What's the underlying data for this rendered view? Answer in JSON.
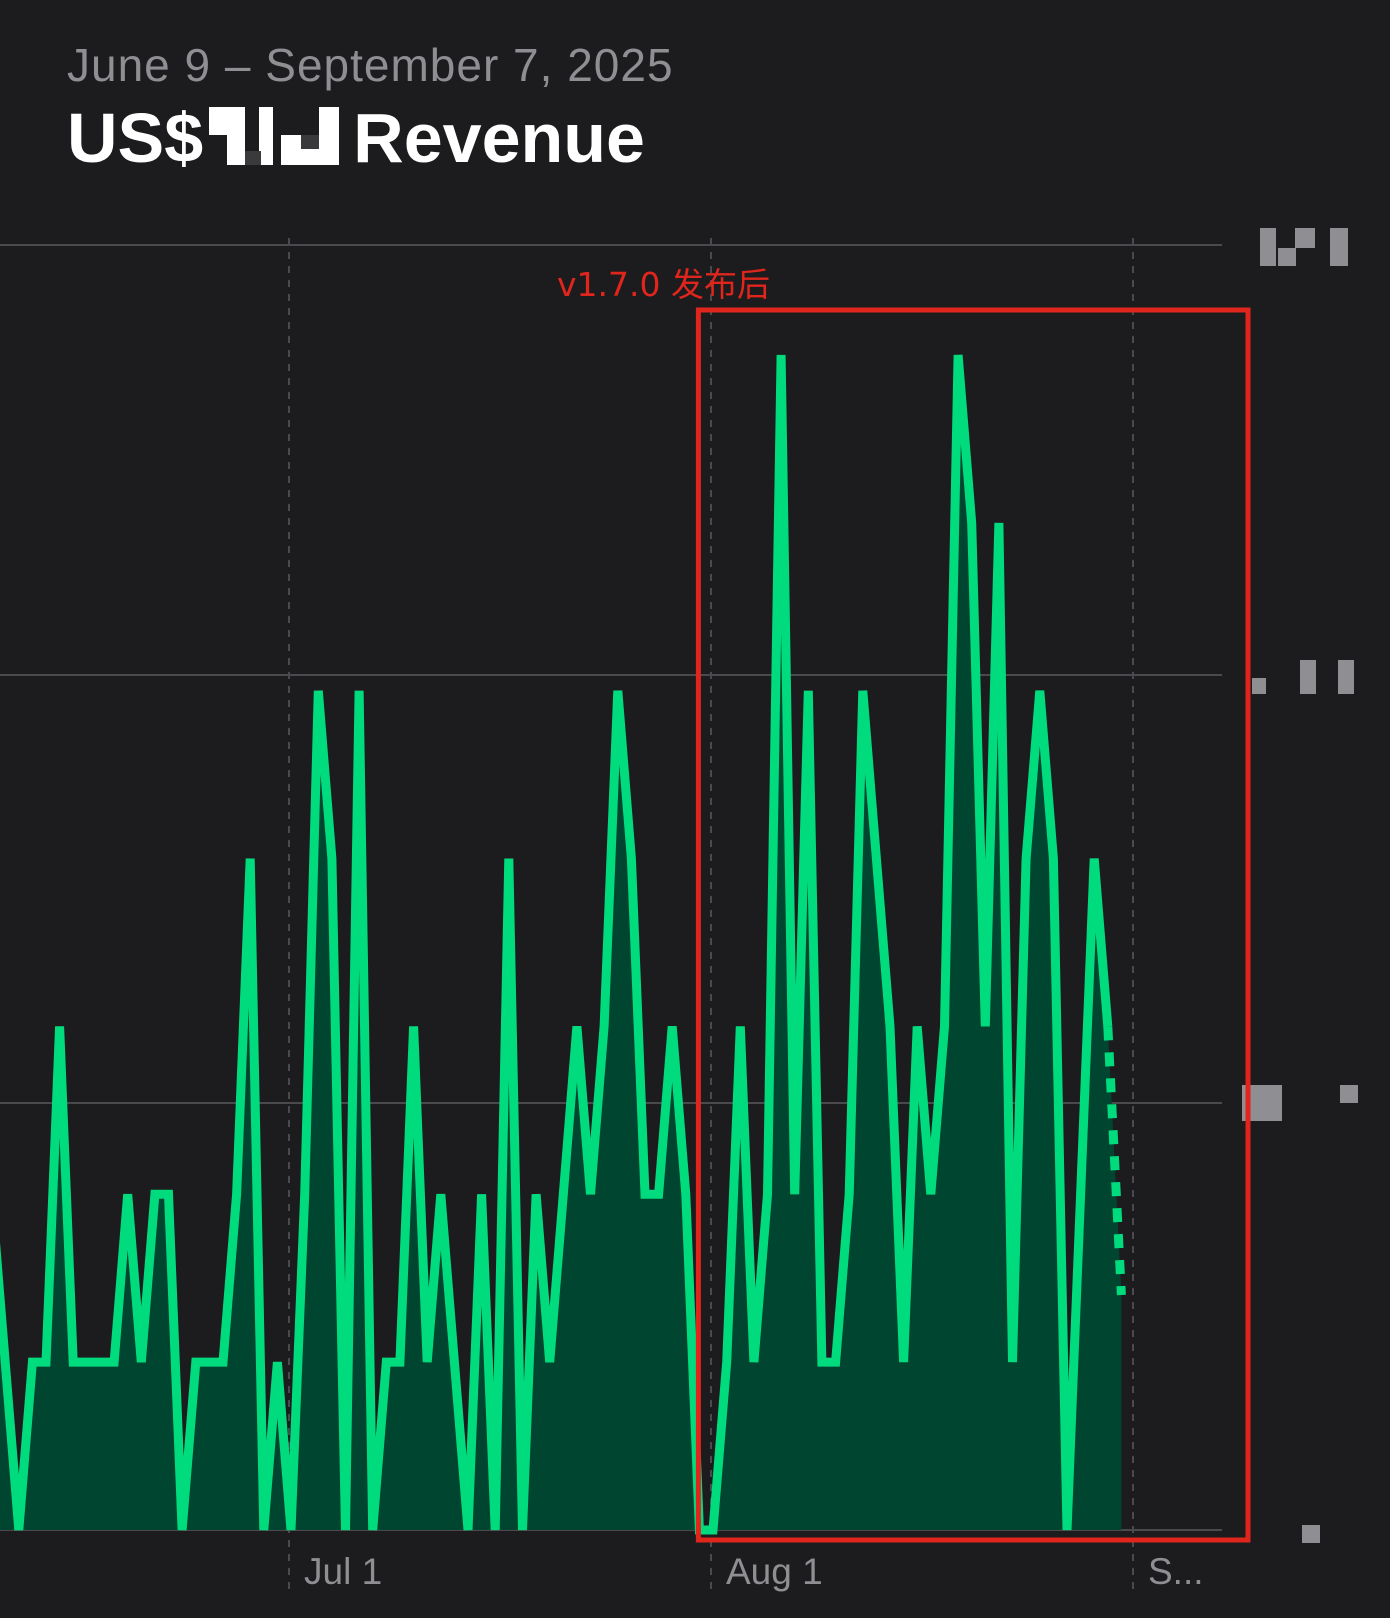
{
  "header": {
    "date_range": "June 9 – September 7, 2025",
    "currency_prefix": "US$",
    "title": "Revenue"
  },
  "colors": {
    "background": "#1c1c1e",
    "line": "#00dc7d",
    "area_fill": "#00452f",
    "gridline": "#4a4a4e",
    "annotation": "#e0261c"
  },
  "annotation": {
    "label": "v1.7.0 发布后",
    "start_date": "2025-07-31",
    "end_date": "2025-09-06"
  },
  "chart_data": {
    "type": "area",
    "title": "Revenue",
    "subtitle": "June 9 – September 7, 2025",
    "xlabel": "",
    "ylabel": "",
    "x_tick_labels": [
      "Jul 1",
      "Aug 1",
      "S..."
    ],
    "x_ticks": [
      "2025-07-01",
      "2025-08-01",
      "2025-09-01"
    ],
    "y_tick_labels_redacted": true,
    "ylim": [
      0,
      3
    ],
    "grid": true,
    "legend": "none",
    "x_start": "2025-06-09",
    "x_end": "2025-09-07",
    "series": [
      {
        "values": [
          1,
          2,
          2,
          1,
          0,
          1,
          1,
          3,
          1,
          1,
          1,
          1,
          2,
          1,
          2,
          2,
          0,
          1,
          1,
          1,
          2,
          4,
          0,
          1,
          0,
          2,
          5,
          4,
          0,
          5,
          0,
          1,
          1,
          3,
          1,
          2,
          1,
          0,
          2,
          0,
          4,
          0,
          2,
          1,
          2,
          3,
          2,
          3,
          5,
          4,
          2,
          2,
          3,
          2,
          0,
          0,
          1,
          3,
          1,
          2,
          7,
          2,
          5,
          1,
          1,
          2,
          5,
          4,
          3,
          1,
          3,
          2,
          3,
          7,
          6,
          3,
          6,
          1,
          4,
          5,
          4,
          0,
          2,
          4,
          3,
          1.4
        ],
        "dashed_last_segment": true
      }
    ]
  }
}
